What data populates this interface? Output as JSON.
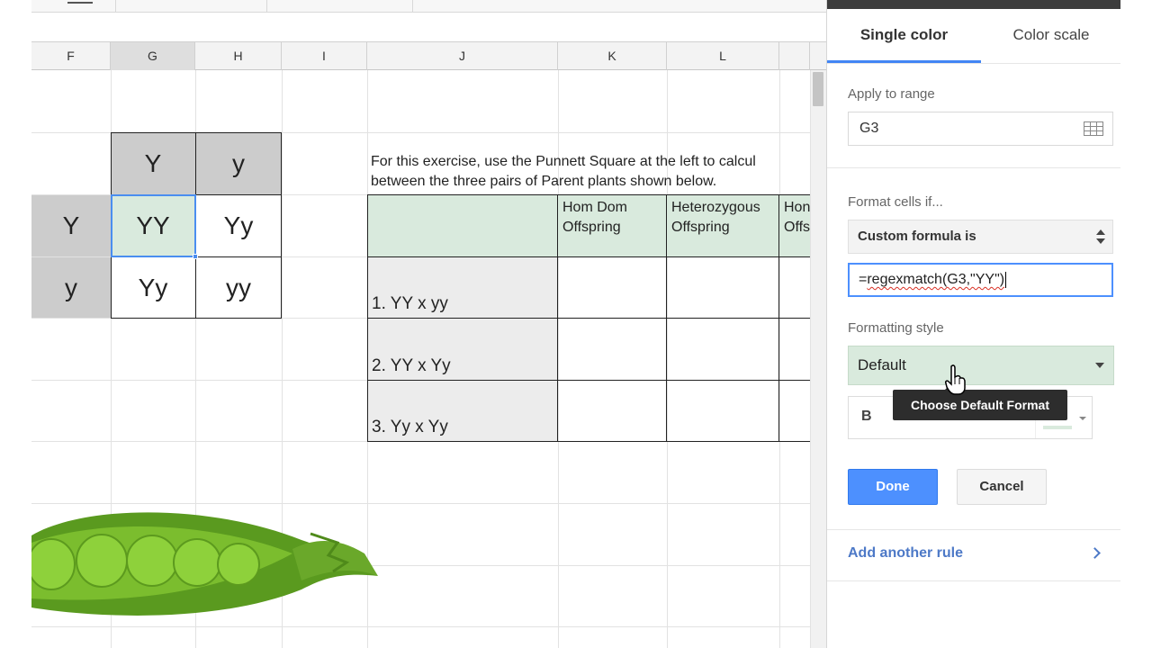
{
  "columns": [
    "F",
    "G",
    "H",
    "I",
    "J",
    "K",
    "L"
  ],
  "selected_column": "G",
  "punnett": {
    "top": [
      "Y",
      "y"
    ],
    "left": [
      "Y",
      "y"
    ],
    "cells": [
      [
        "YY",
        "Yy"
      ],
      [
        "Yy",
        "yy"
      ]
    ]
  },
  "instructions": {
    "line1": "For this exercise, use the Punnett Square at the left to calcul",
    "line2": "between the three pairs of Parent plants shown below."
  },
  "offspring_table": {
    "headers": [
      [
        "Hom Dom",
        "Offspring"
      ],
      [
        "Heterozygous",
        "Offspring"
      ],
      [
        "Hon",
        "Offs"
      ]
    ],
    "rows": [
      "1.  YY x yy",
      "2.  YY x Yy",
      "3.  Yy x Yy"
    ]
  },
  "panel": {
    "tabs": [
      "Single color",
      "Color scale"
    ],
    "active_tab": "Single color",
    "apply_label": "Apply to range",
    "apply_value": "G3",
    "format_if_label": "Format cells if...",
    "condition": "Custom formula is",
    "formula_prefix": "=",
    "formula_body": "regexmatch(G3,\"YY\")",
    "style_label": "Formatting style",
    "style_value": "Default",
    "tooltip": "Choose Default Format",
    "bold": "B",
    "done": "Done",
    "cancel": "Cancel",
    "add_rule": "Add another rule"
  },
  "colors": {
    "accent": "#4285f4",
    "highlight_green": "#d9eadd",
    "punnett_gray": "#cccccc",
    "link_blue": "#4d79c7"
  },
  "icons": [
    "grid-range-icon",
    "updown-icon",
    "dropdown-arrow-icon",
    "fill-color-icon",
    "chevron-right-icon",
    "hand-cursor-icon"
  ]
}
